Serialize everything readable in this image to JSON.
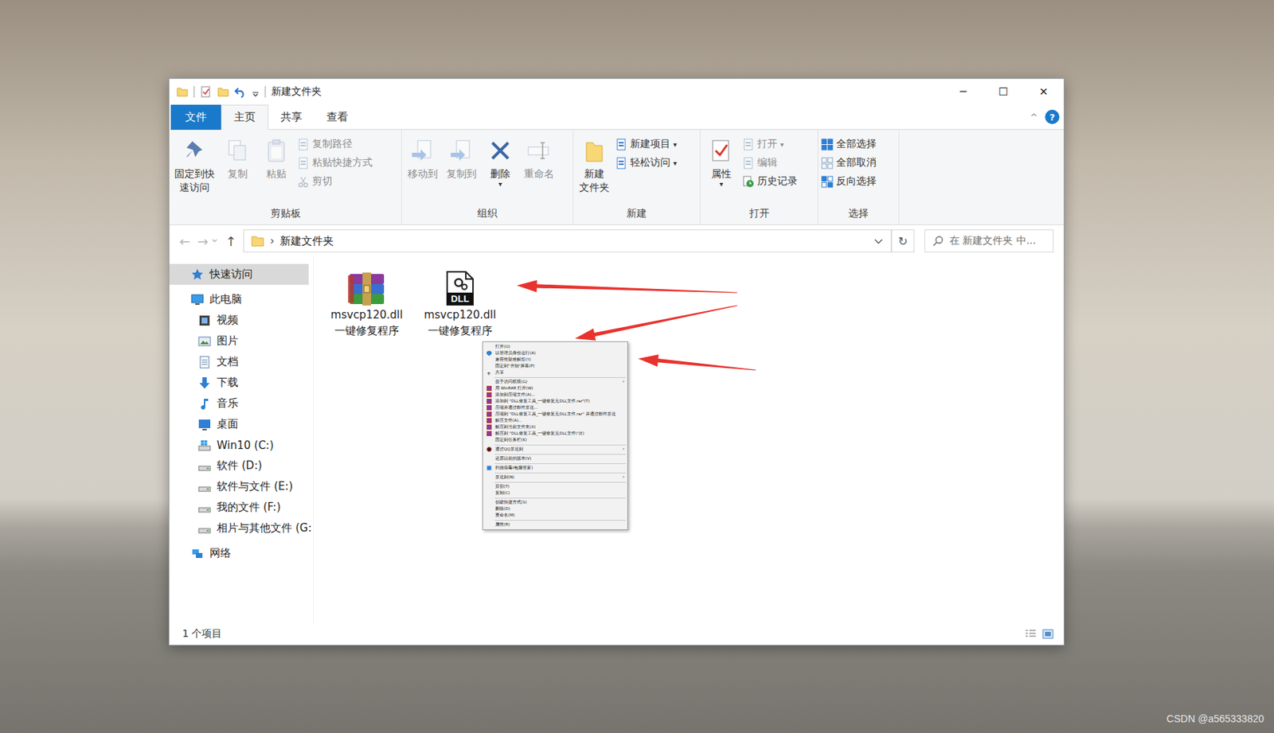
{
  "window": {
    "title": "新建文件夹",
    "controls": [
      "─",
      "☐",
      "✕"
    ]
  },
  "ribbon": {
    "tabs": [
      {
        "label": "文件",
        "selected": false,
        "kind": "file"
      },
      {
        "label": "主页",
        "selected": true,
        "kind": "tab"
      },
      {
        "label": "共享",
        "selected": false,
        "kind": "tab"
      },
      {
        "label": "查看",
        "selected": false,
        "kind": "tab"
      }
    ],
    "collapse": "^",
    "help": "?",
    "groups": [
      {
        "label": "剪贴板",
        "large": [
          {
            "lines": [
              "固定到快",
              "速访问"
            ],
            "kind": "pin",
            "disabled": false
          },
          {
            "lines": [
              "复制"
            ],
            "kind": "copy",
            "disabled": true
          },
          {
            "lines": [
              "粘贴"
            ],
            "kind": "paste",
            "disabled": true
          }
        ],
        "small": [
          {
            "label": "复制路径",
            "kind": "path",
            "disabled": true
          },
          {
            "label": "粘贴快捷方式",
            "kind": "shortcut",
            "disabled": true
          },
          {
            "label": "剪切",
            "kind": "cut",
            "disabled": true
          }
        ]
      },
      {
        "label": "组织",
        "large": [
          {
            "lines": [
              "移动到"
            ],
            "kind": "move",
            "disabled": true
          },
          {
            "lines": [
              "复制到"
            ],
            "kind": "copyto",
            "disabled": true
          },
          {
            "lines": [
              "删除"
            ],
            "kind": "delete",
            "disabled": false,
            "caret": "▾"
          },
          {
            "lines": [
              "重命名"
            ],
            "kind": "rename",
            "disabled": true
          }
        ],
        "small": []
      },
      {
        "label": "新建",
        "large": [
          {
            "lines": [
              "新建",
              "文件夹"
            ],
            "kind": "newfolder",
            "disabled": false
          }
        ],
        "small": [
          {
            "label": "新建项目",
            "kind": "newitem",
            "disabled": false,
            "caret": "▾"
          },
          {
            "label": "轻松访问",
            "kind": "easy",
            "disabled": false,
            "caret": "▾"
          }
        ]
      },
      {
        "label": "打开",
        "large": [
          {
            "lines": [
              "属性"
            ],
            "kind": "props",
            "disabled": false,
            "caret": "▾"
          }
        ],
        "small": [
          {
            "label": "打开",
            "kind": "open",
            "disabled": true,
            "caret": "▾"
          },
          {
            "label": "编辑",
            "kind": "edit",
            "disabled": true
          },
          {
            "label": "历史记录",
            "kind": "history",
            "disabled": false
          }
        ]
      },
      {
        "label": "选择",
        "large": [],
        "small": [
          {
            "label": "全部选择",
            "kind": "selall",
            "disabled": false
          },
          {
            "label": "全部取消",
            "kind": "selnone",
            "disabled": false
          },
          {
            "label": "反向选择",
            "kind": "selinv",
            "disabled": false
          }
        ]
      }
    ]
  },
  "address_bar": {
    "back": "←",
    "forward": "→",
    "up": "↑",
    "separator": "›",
    "path": "新建文件夹",
    "refresh": "↻"
  },
  "search": {
    "placeholder": "在 新建文件夹 中..."
  },
  "sidebar": {
    "items": [
      {
        "label": "快速访问",
        "kind": "star",
        "level": 0,
        "selected": true
      },
      {
        "label": "此电脑",
        "kind": "pc",
        "level": 0,
        "selected": false
      },
      {
        "label": "视频",
        "kind": "video",
        "level": 1,
        "selected": false
      },
      {
        "label": "图片",
        "kind": "picture",
        "level": 1,
        "selected": false
      },
      {
        "label": "文档",
        "kind": "doc",
        "level": 1,
        "selected": false
      },
      {
        "label": "下载",
        "kind": "download",
        "level": 1,
        "selected": false
      },
      {
        "label": "音乐",
        "kind": "music",
        "level": 1,
        "selected": false
      },
      {
        "label": "桌面",
        "kind": "desktop",
        "level": 1,
        "selected": false
      },
      {
        "label": "Win10 (C:)",
        "kind": "drive-win",
        "level": 1,
        "selected": false
      },
      {
        "label": "软件 (D:)",
        "kind": "drive",
        "level": 1,
        "selected": false
      },
      {
        "label": "软件与文件 (E:)",
        "kind": "drive",
        "level": 1,
        "selected": false
      },
      {
        "label": "我的文件 (F:)",
        "kind": "drive",
        "level": 1,
        "selected": false
      },
      {
        "label": "相片与其他文件 (G:",
        "kind": "drive",
        "level": 1,
        "selected": false
      },
      {
        "label": "网络",
        "kind": "network",
        "level": 0,
        "selected": false
      }
    ]
  },
  "files": [
    {
      "lines": [
        "msvcp120.dll",
        "一键修复程序"
      ],
      "kind": "archive",
      "selected": false
    },
    {
      "lines": [
        "msvcp120.dll",
        "一键修复程序"
      ],
      "kind": "dll",
      "badge": "DLL",
      "selected": false
    }
  ],
  "context_menu": {
    "items": [
      {
        "label": "打开(O)",
        "kind": "plain"
      },
      {
        "label": "以管理员身份运行(A)",
        "kind": "shield"
      },
      {
        "label": "兼容性疑难解答(Y)",
        "kind": "plain"
      },
      {
        "label": "固定到\"开始\"屏幕(P)",
        "kind": "plain"
      },
      {
        "label": "共享",
        "kind": "share"
      },
      {
        "kind": "separator"
      },
      {
        "label": "授予访问权限(G)",
        "kind": "plain",
        "arrow": "›"
      },
      {
        "label": "用 WinRAR 打开(W)",
        "kind": "winrar"
      },
      {
        "label": "添加到压缩文件(A)...",
        "kind": "winrar"
      },
      {
        "label": "添加到 \"DLL修复工具_一键修复无DLL文件.rar\"(T)",
        "kind": "winrar"
      },
      {
        "label": "压缩并通过邮件发送...",
        "kind": "winrar"
      },
      {
        "label": "压缩到 \"DLL修复工具_一键修复无DLL文件.rar\" 并通过邮件发送",
        "kind": "winrar"
      },
      {
        "label": "解压文件(A)...",
        "kind": "winrar"
      },
      {
        "label": "解压到当前文件夹(X)",
        "kind": "winrar"
      },
      {
        "label": "解压到 \"DLL修复工具_一键修复无DLL文件\\\"(E)",
        "kind": "winrar"
      },
      {
        "label": "固定到任务栏(K)",
        "kind": "plain"
      },
      {
        "kind": "separator"
      },
      {
        "label": "通过QQ发送到",
        "kind": "qq",
        "arrow": "›"
      },
      {
        "kind": "separator"
      },
      {
        "label": "还原以前的版本(V)",
        "kind": "plain"
      },
      {
        "kind": "separator"
      },
      {
        "label": "扫描病毒(电脑管家)",
        "kind": "scan"
      },
      {
        "kind": "separator"
      },
      {
        "label": "发送到(N)",
        "kind": "plain",
        "arrow": "›"
      },
      {
        "kind": "separator"
      },
      {
        "label": "剪切(T)",
        "kind": "plain"
      },
      {
        "label": "复制(C)",
        "kind": "plain"
      },
      {
        "kind": "separator"
      },
      {
        "label": "创建快捷方式(S)",
        "kind": "plain"
      },
      {
        "label": "删除(D)",
        "kind": "plain"
      },
      {
        "label": "重命名(M)",
        "kind": "plain"
      },
      {
        "kind": "separator"
      },
      {
        "label": "属性(R)",
        "kind": "plain"
      }
    ]
  },
  "status_bar": {
    "count": "1 个项目"
  },
  "watermark": "CSDN @a565333820"
}
